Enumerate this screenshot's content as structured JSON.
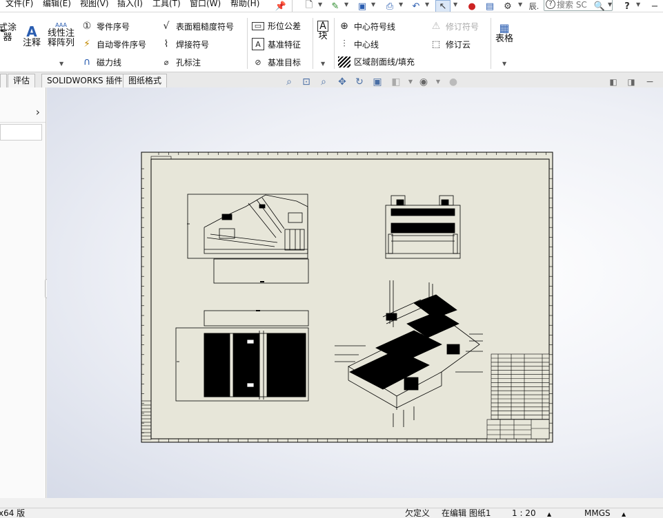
{
  "menubar": {
    "items": [
      "文件(F)",
      "编辑(E)",
      "视图(V)",
      "插入(I)",
      "工具(T)",
      "窗口(W)",
      "帮助(H)"
    ],
    "search_placeholder": "搜索 SC",
    "help_label": "?"
  },
  "ribbon": {
    "left_cut_top": "式涂",
    "left_cut_bottom": "器",
    "annotation_label": "注释",
    "linear_note_line1": "线性注",
    "linear_note_line2": "释阵列",
    "balloon_label": "零件序号",
    "auto_balloon_label": "自动零件序号",
    "magnetic_line_label": "磁力线",
    "surface_finish_label": "表面粗糙度符号",
    "weld_symbol_label": "焊接符号",
    "hole_callout_label": "孔标注",
    "geometric_tolerance_label": "形位公差",
    "datum_feature_label": "基准特征",
    "datum_target_label": "基准目标",
    "block_label": "块",
    "center_mark_label": "中心符号线",
    "centerline_label": "中心线",
    "area_hatch_label": "区域剖面线/填充",
    "revision_symbol_label": "修订符号",
    "revision_cloud_label": "修订云",
    "table_label": "表格"
  },
  "tabs": [
    "评估",
    "SOLIDWORKS 插件",
    "图纸格式"
  ],
  "statusbar": {
    "version": "x64 版",
    "undefined": "欠定义",
    "editing": "在编辑 图纸1",
    "scale": "1 : 20",
    "units": "MMGS"
  },
  "colors": {
    "sheet_bg": "#e7e6d9",
    "graphics_bg": "#eef0f6",
    "line": "#000000"
  }
}
